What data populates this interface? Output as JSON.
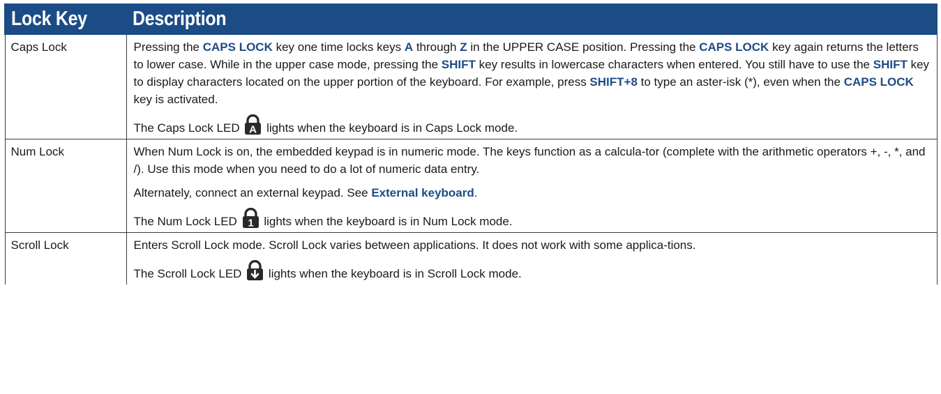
{
  "header": {
    "col1": "Lock Key",
    "col2": "Description"
  },
  "rows": [
    {
      "key": "Caps Lock",
      "p1": {
        "t1": "Pressing the ",
        "b1": "CAPS LOCK",
        "t2": " key one time locks keys ",
        "b2": "A",
        "t3": " through ",
        "b3": "Z",
        "t4": " in the UPPER CASE position. Pressing the ",
        "b4": "CAPS LOCK",
        "t5": " key again returns the letters to lower case. While in the upper case mode, pressing the ",
        "b5": "SHIFT",
        "t6": " key results in lowercase characters when entered. You still have to use the ",
        "b6": "SHIFT",
        "t7": " key to display characters located on the upper portion of the keyboard. For example, press ",
        "b7": "SHIFT+8",
        "t8": " to type an aster-isk (*), even when the ",
        "b8": "CAPS LOCK",
        "t9": " key is activated."
      },
      "led": {
        "before": "The Caps Lock LED",
        "after": "lights when the keyboard is in Caps Lock mode.",
        "icon": "caps-lock-led-icon",
        "glyph": "A"
      }
    },
    {
      "key": "Num Lock",
      "p1": "When Num Lock is on, the embedded keypad is in numeric mode. The keys function as a calcula-tor (complete with the arithmetic operators +, -, *, and /). Use this mode when you need to do a lot of numeric data entry.",
      "p2": {
        "text": "Alternately, connect an external keypad. See ",
        "link": "External keyboard",
        "end": "."
      },
      "led": {
        "before": "The Num Lock LED",
        "after": "lights when the keyboard is in Num Lock mode.",
        "icon": "num-lock-led-icon",
        "glyph": "1"
      }
    },
    {
      "key": "Scroll Lock",
      "p1": "Enters Scroll Lock mode. Scroll Lock varies between applications. It does not work with some applica-tions.",
      "led": {
        "before": "The Scroll Lock LED",
        "after": "lights when the keyboard is in Scroll  Lock mode.",
        "icon": "scroll-lock-led-icon"
      }
    }
  ],
  "colors": {
    "header_bg": "#1c4c86",
    "accent_text": "#1c4c86",
    "border": "#3b3b3b"
  }
}
